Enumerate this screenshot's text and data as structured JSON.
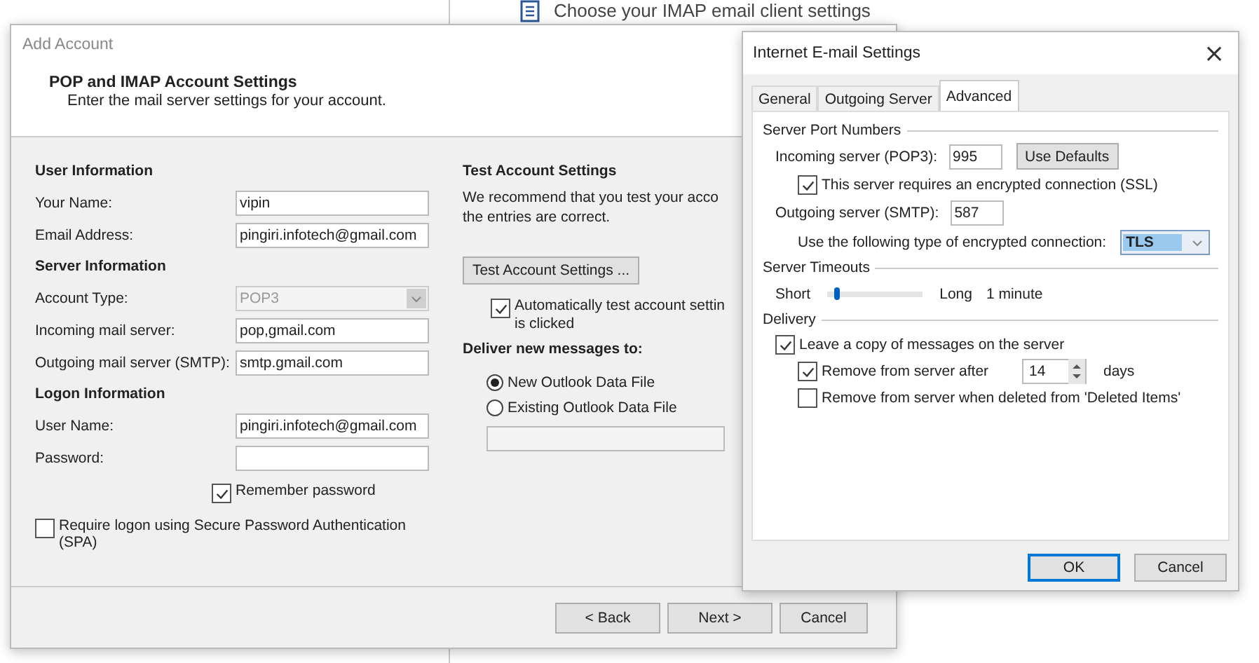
{
  "background": {
    "heading": "Choose your IMAP email client settings"
  },
  "add_account": {
    "title": "Add Account",
    "heading": "POP and IMAP Account Settings",
    "subheading": "Enter the mail server settings for your account.",
    "sections": [
      {
        "title": "User Information",
        "fields": [
          {
            "kind": "text",
            "label": "Your Name:",
            "value": "vipin"
          },
          {
            "kind": "text",
            "label": "Email Address:",
            "value": "pingiri.infotech@gmail.com"
          }
        ]
      },
      {
        "title": "Server Information",
        "fields": [
          {
            "kind": "select",
            "label": "Account Type:",
            "value": "POP3",
            "disabled": true
          },
          {
            "kind": "text",
            "label": "Incoming mail server:",
            "value": "pop,gmail.com"
          },
          {
            "kind": "text",
            "label": "Outgoing mail server (SMTP):",
            "value": "smtp.gmail.com"
          }
        ]
      },
      {
        "title": "Logon Information",
        "fields": [
          {
            "kind": "text",
            "label": "User Name:",
            "value": "pingiri.infotech@gmail.com"
          },
          {
            "kind": "text",
            "label": "Password:"
          }
        ]
      }
    ],
    "remember_password": {
      "label": "Remember password",
      "checked": true
    },
    "spa": {
      "label": "Require logon using Secure Password Authentication (SPA)",
      "checked": false
    },
    "test": {
      "title": "Test Account Settings",
      "description": [
        "We recommend that you test your acco",
        "the entries are correct."
      ],
      "button": "Test Account Settings ...",
      "auto_test": {
        "lines": [
          "Automatically test account settin",
          "is clicked"
        ],
        "checked": true
      }
    },
    "deliver": {
      "title": "Deliver new messages to:",
      "options": [
        {
          "label": "New Outlook Data File",
          "selected": true
        },
        {
          "label": "Existing Outlook Data File",
          "selected": false
        }
      ]
    },
    "buttons": [
      "< Back",
      "Next >",
      "Cancel"
    ]
  },
  "email_settings": {
    "title": "Internet E-mail Settings",
    "close": "×",
    "tabs": [
      {
        "label": "General",
        "selected": false
      },
      {
        "label": "Outgoing Server",
        "selected": false
      },
      {
        "label": "Advanced",
        "selected": true
      }
    ],
    "ports": {
      "title": "Server Port Numbers",
      "incoming_label": "Incoming server (POP3):",
      "incoming_port": "995",
      "use_defaults": "Use Defaults",
      "ssl": {
        "label": "This server requires an encrypted connection (SSL)",
        "checked": true
      },
      "outgoing_label": "Outgoing server (SMTP):",
      "outgoing_port": "587",
      "encryption_label": "Use the following type of encrypted connection:",
      "encryption": "TLS"
    },
    "timeouts": {
      "title": "Server Timeouts",
      "short": "Short",
      "long": "Long",
      "level": 0.1,
      "reading": "1 minute"
    },
    "delivery": {
      "title": "Delivery",
      "leave_copy": {
        "label": "Leave a copy of messages on the server",
        "checked": true
      },
      "remove_after": {
        "label": "Remove from server after",
        "checked": true,
        "value": "14",
        "unit": "days"
      },
      "remove_deleted": {
        "label": "Remove from server when deleted from 'Deleted Items'",
        "checked": false
      }
    },
    "buttons": [
      "OK",
      "Cancel"
    ]
  }
}
